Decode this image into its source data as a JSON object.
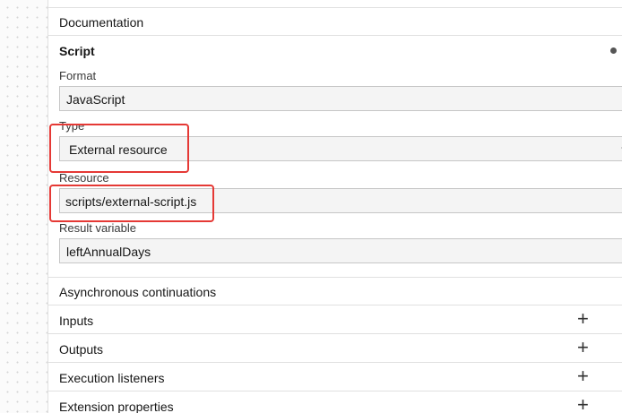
{
  "panel": {
    "documentation_label": "Documentation",
    "script": {
      "title": "Script",
      "format_label": "Format",
      "format_value": "JavaScript",
      "type_label": "Type",
      "type_value": "External resource",
      "resource_label": "Resource",
      "resource_value": "scripts/external-script.js",
      "result_variable_label": "Result variable",
      "result_variable_value": "leftAnnualDays"
    },
    "groups": [
      {
        "label": "Asynchronous continuations",
        "expandable": false
      },
      {
        "label": "Inputs",
        "expandable": true
      },
      {
        "label": "Outputs",
        "expandable": true
      },
      {
        "label": "Execution listeners",
        "expandable": true
      },
      {
        "label": "Extension properties",
        "expandable": true
      }
    ],
    "add_icon_glyph": "+"
  },
  "highlight_color": "#e53935"
}
